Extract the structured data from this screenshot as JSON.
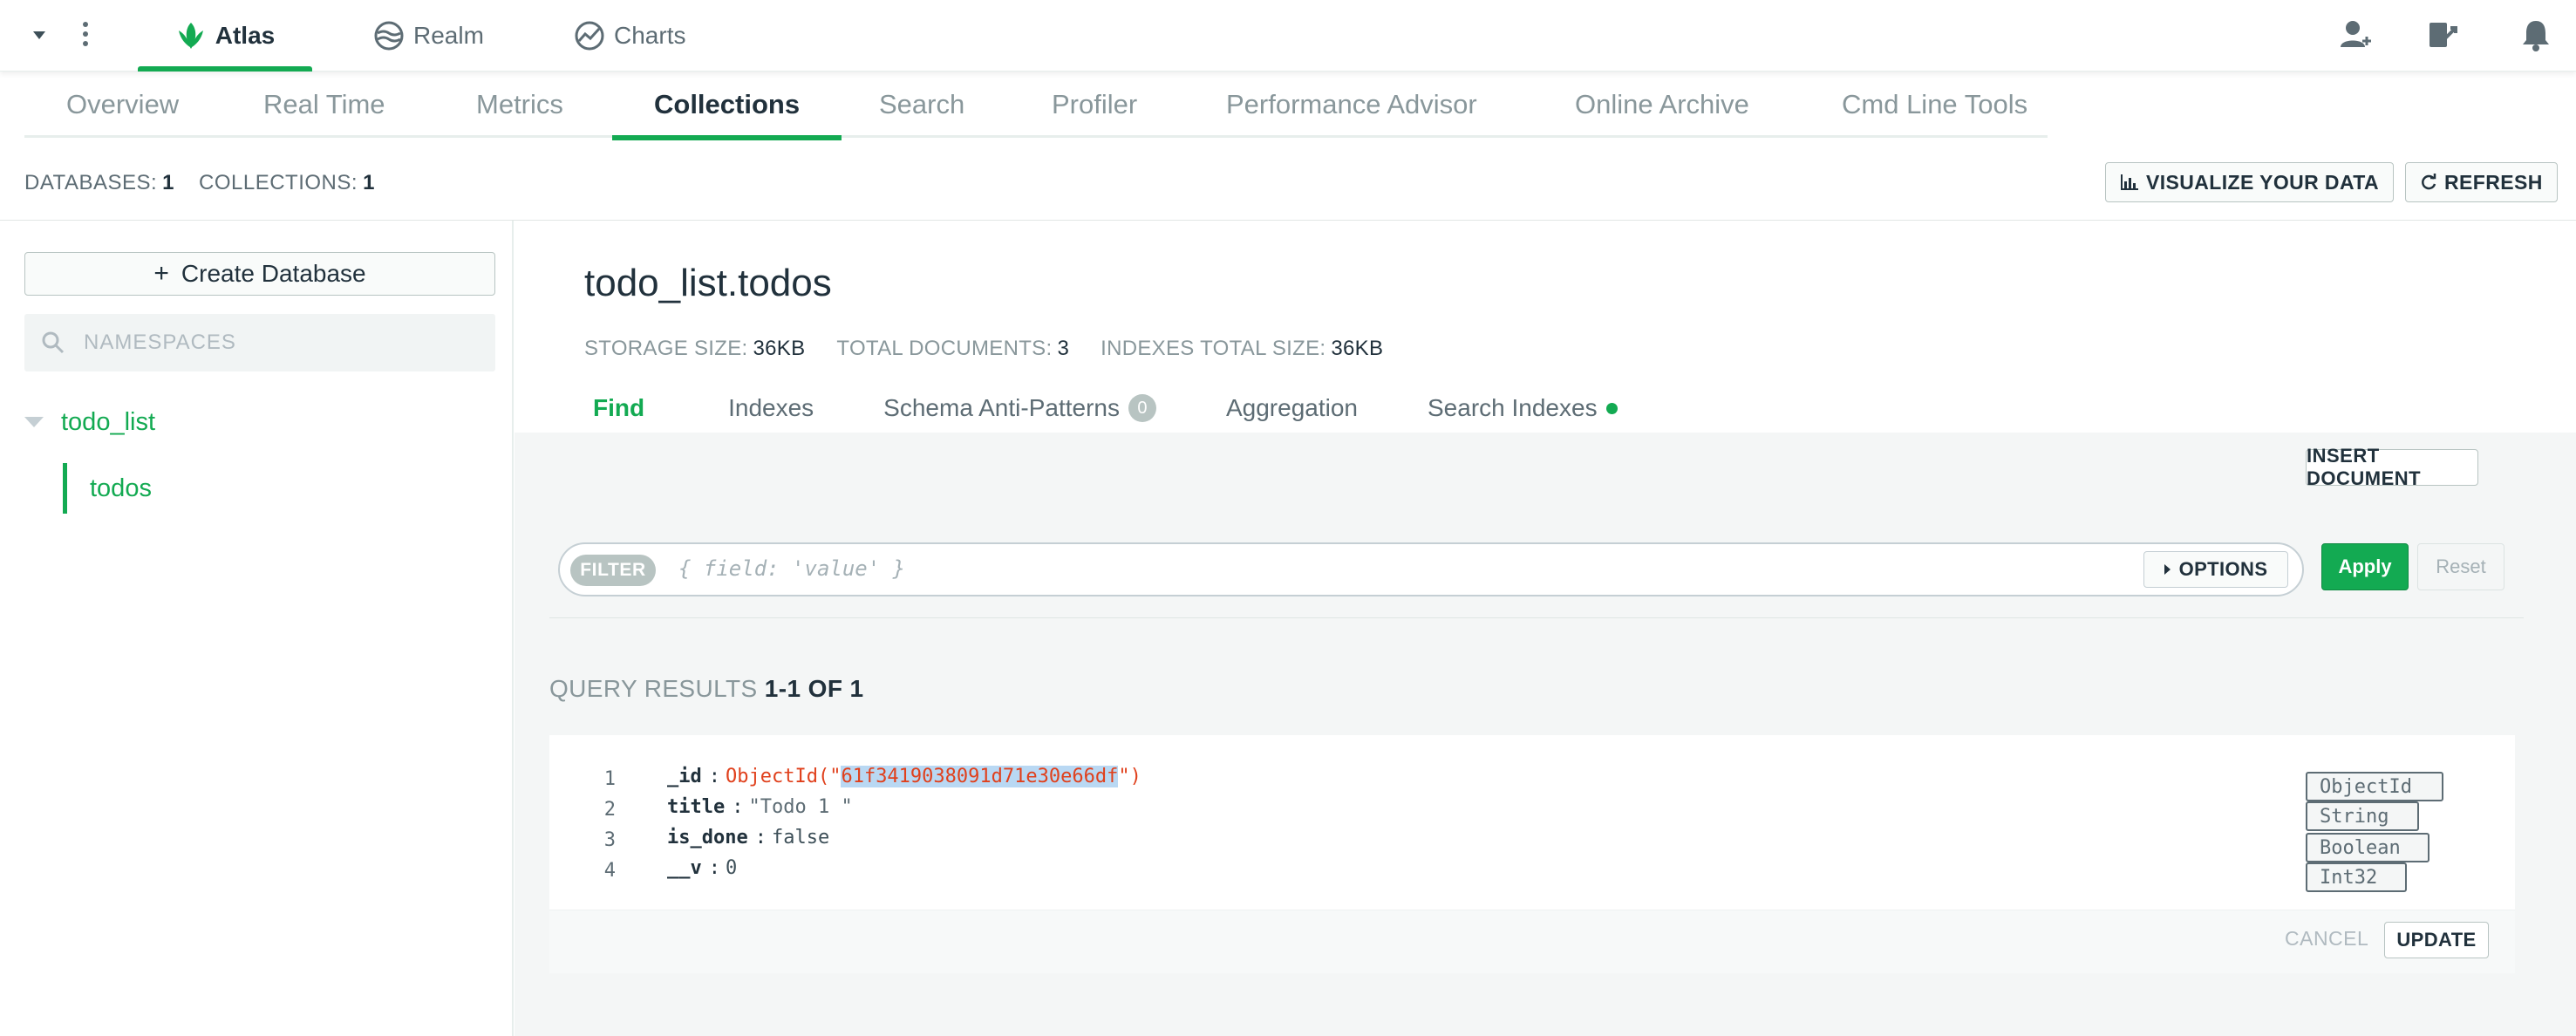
{
  "top_nav": {
    "products": [
      {
        "label": "Atlas",
        "icon": "atlas-leaf-icon",
        "active": true
      },
      {
        "label": "Realm",
        "icon": "realm-icon",
        "active": false
      },
      {
        "label": "Charts",
        "icon": "charts-icon",
        "active": false
      }
    ],
    "right_icons": [
      "invite-user-icon",
      "organization-access-icon",
      "notifications-bell-icon"
    ]
  },
  "section_nav": {
    "items": [
      "Overview",
      "Real Time",
      "Metrics",
      "Collections",
      "Search",
      "Profiler",
      "Performance Advisor",
      "Online Archive",
      "Cmd Line Tools"
    ],
    "active": "Collections"
  },
  "summary": {
    "databases_label": "DATABASES:",
    "databases_count": "1",
    "collections_label": "COLLECTIONS:",
    "collections_count": "1",
    "visualize_label": "VISUALIZE YOUR DATA",
    "refresh_label": "REFRESH"
  },
  "sidebar": {
    "create_db_label": "Create Database",
    "search_placeholder": "NAMESPACES",
    "database": "todo_list",
    "collection": "todos"
  },
  "collection": {
    "namespace": "todo_list.todos",
    "stats": [
      {
        "label": "STORAGE SIZE:",
        "value": "36KB"
      },
      {
        "label": "TOTAL DOCUMENTS:",
        "value": "3"
      },
      {
        "label": "INDEXES TOTAL SIZE:",
        "value": "36KB"
      }
    ],
    "tabs": {
      "find": "Find",
      "indexes": "Indexes",
      "schema": "Schema Anti-Patterns",
      "schema_badge": "0",
      "aggregation": "Aggregation",
      "search_indexes": "Search Indexes"
    },
    "accent_color": "#13aa52"
  },
  "find": {
    "insert_label": "INSERT DOCUMENT",
    "filter_pill": "FILTER",
    "filter_placeholder": "{ field: 'value' }",
    "options_label": "OPTIONS",
    "apply_label": "Apply",
    "reset_label": "Reset",
    "results_prefix": "QUERY RESULTS",
    "results_range": "1-1 OF 1"
  },
  "document": {
    "lines": [
      {
        "num": "1",
        "field": "_id",
        "value_prefix": "ObjectId(\"",
        "value_selected": "61f3419038091d71e30e66df",
        "value_suffix": "\")",
        "type": "ObjectId"
      },
      {
        "num": "2",
        "field": "title",
        "value": "\"Todo 1 \"",
        "type": "String"
      },
      {
        "num": "3",
        "field": "is_done",
        "value": "false",
        "type": "Boolean"
      },
      {
        "num": "4",
        "field": "__v",
        "value": "0",
        "type": "Int32"
      }
    ],
    "cancel_label": "CANCEL",
    "update_label": "UPDATE"
  }
}
